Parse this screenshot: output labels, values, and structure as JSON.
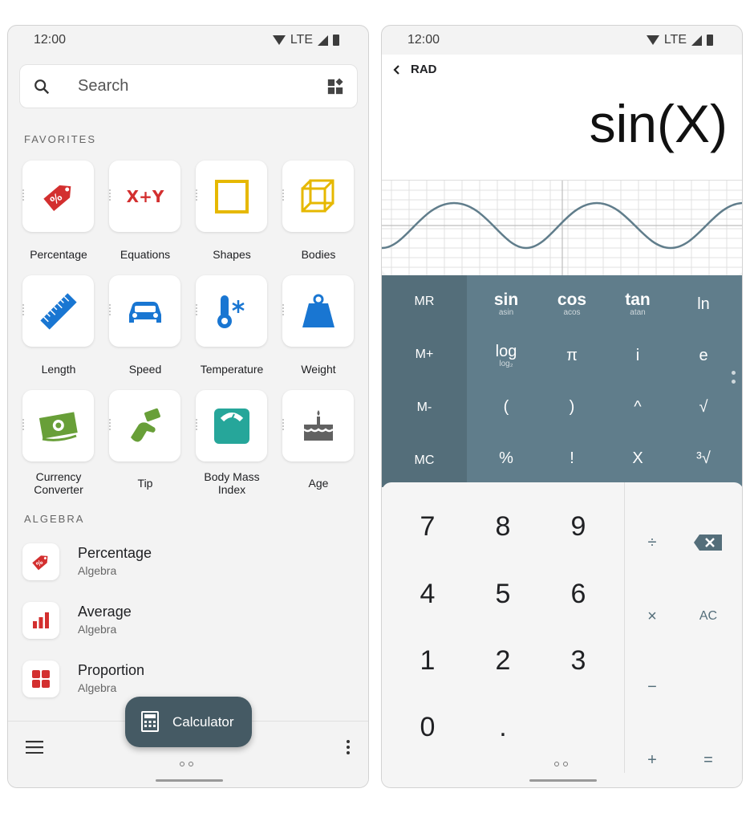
{
  "left": {
    "status": {
      "time": "12:00",
      "network": "LTE"
    },
    "search": {
      "placeholder": "Search"
    },
    "favorites_header": "FAVORITES",
    "favorites": [
      {
        "label": "Percentage",
        "icon": "percentage-tag-icon",
        "color": "#d32f2f"
      },
      {
        "label": "Equations",
        "icon": "equations-xy-icon",
        "color": "#d32f2f"
      },
      {
        "label": "Shapes",
        "icon": "square-shape-icon",
        "color": "#e6b800"
      },
      {
        "label": "Bodies",
        "icon": "cube-icon",
        "color": "#e6b800"
      },
      {
        "label": "Length",
        "icon": "ruler-icon",
        "color": "#1976d2"
      },
      {
        "label": "Speed",
        "icon": "car-icon",
        "color": "#1976d2"
      },
      {
        "label": "Temperature",
        "icon": "thermometer-snowflake-icon",
        "color": "#1976d2"
      },
      {
        "label": "Weight",
        "icon": "weight-icon",
        "color": "#1976d2"
      },
      {
        "label": "Currency\nConverter",
        "icon": "banknote-icon",
        "color": "#689f38"
      },
      {
        "label": "Tip",
        "icon": "tip-hand-icon",
        "color": "#689f38"
      },
      {
        "label": "Body Mass\nIndex",
        "icon": "scale-icon",
        "color": "#26a69a"
      },
      {
        "label": "Age",
        "icon": "cake-icon",
        "color": "#616161"
      }
    ],
    "algebra_header": "ALGEBRA",
    "algebra_items": [
      {
        "title": "Percentage",
        "subtitle": "Algebra",
        "icon": "percentage-tag-icon"
      },
      {
        "title": "Average",
        "subtitle": "Algebra",
        "icon": "bar-chart-icon"
      },
      {
        "title": "Proportion",
        "subtitle": "Algebra",
        "icon": "grid-squares-icon"
      }
    ],
    "fab": {
      "label": "Calculator",
      "icon": "calculator-icon"
    }
  },
  "right": {
    "status": {
      "time": "12:00",
      "network": "LTE"
    },
    "mode": "RAD",
    "expression": "sin(X)",
    "memory_keys": [
      "MR",
      "M+",
      "M-",
      "MC"
    ],
    "sci_keys": [
      {
        "main": "sin",
        "sub": "asin"
      },
      {
        "main": "cos",
        "sub": "acos"
      },
      {
        "main": "tan",
        "sub": "atan"
      },
      {
        "main": "ln",
        "sub": ""
      },
      {
        "main": "log",
        "sub": "log₂"
      },
      {
        "main": "π",
        "sub": ""
      },
      {
        "main": "i",
        "sub": ""
      },
      {
        "main": "e",
        "sub": ""
      },
      {
        "main": "(",
        "sub": ""
      },
      {
        "main": ")",
        "sub": ""
      },
      {
        "main": "^",
        "sub": ""
      },
      {
        "main": "√",
        "sub": ""
      },
      {
        "main": "%",
        "sub": ""
      },
      {
        "main": "!",
        "sub": ""
      },
      {
        "main": "X",
        "sub": ""
      },
      {
        "main": "³√",
        "sub": ""
      }
    ],
    "number_keys": [
      "7",
      "8",
      "9",
      "4",
      "5",
      "6",
      "1",
      "2",
      "3",
      "0",
      "."
    ],
    "op_keys": {
      "divide": "÷",
      "multiply": "×",
      "minus": "−",
      "plus": "+",
      "equals": "=",
      "clear": "AC"
    },
    "accent": "#607d8b"
  }
}
